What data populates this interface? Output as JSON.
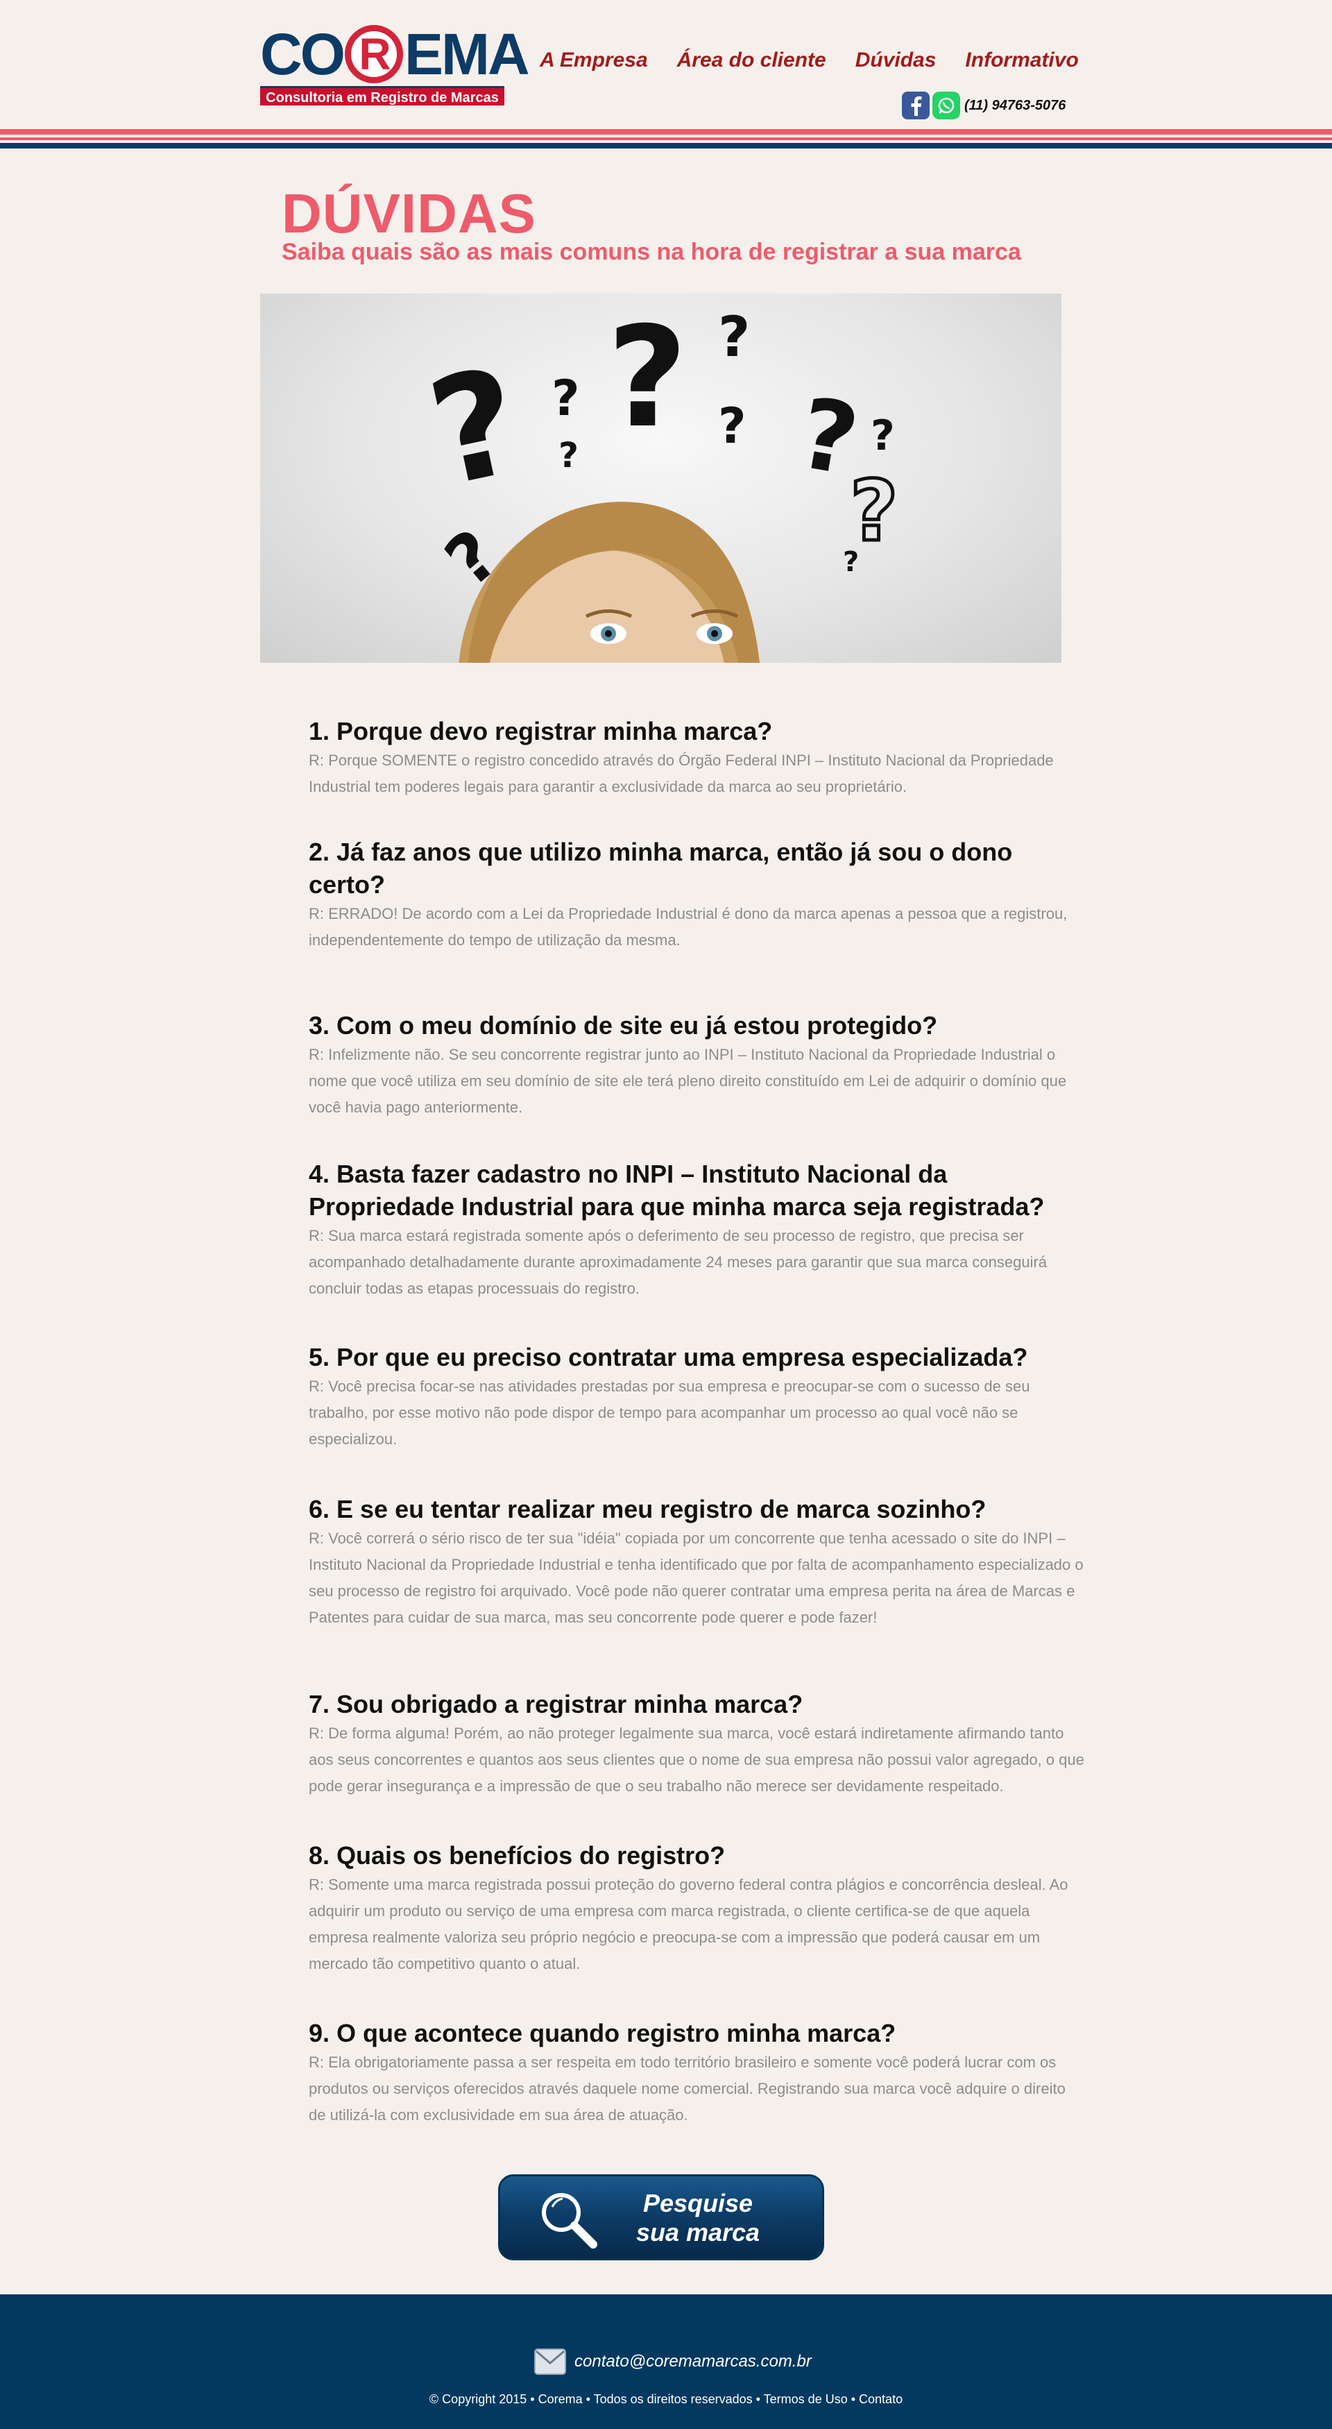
{
  "header": {
    "logo_word_start": "CO",
    "logo_word_r": "R",
    "logo_word_end": "EMA",
    "logo_tagline": "Consultoria em Registro de Marcas",
    "nav": [
      "A Empresa",
      "Área do cliente",
      "Dúvidas",
      "Informativo"
    ],
    "phone": "(11) 94763-5076"
  },
  "page": {
    "title": "DÚVIDAS",
    "subtitle": "Saiba quais são as mais comuns na hora de registrar a sua marca"
  },
  "faq": [
    {
      "question": "1. Porque devo registrar minha marca?",
      "answer": "R: Porque SOMENTE o registro concedido através do Órgão Federal INPI – Instituto Nacional da Propriedade Industrial tem poderes legais para garantir a exclusividade da marca ao seu proprietário."
    },
    {
      "question": "2. Já faz anos que utilizo minha marca, então já sou o dono certo?",
      "answer": "R: ERRADO! De acordo com a Lei da Propriedade Industrial é dono da marca apenas a pessoa que a registrou, independentemente do tempo de utilização da mesma."
    },
    {
      "question": "3. Com o meu domínio de site eu já estou protegido?",
      "answer": "R: Infelizmente não. Se seu concorrente registrar junto ao INPI – Instituto Nacional da Propriedade Industrial o nome que você utiliza em seu domínio de site ele terá pleno direito constituído em Lei de adquirir o domínio que você havia pago anteriormente."
    },
    {
      "question": "4. Basta fazer cadastro no INPI – Instituto Nacional da Propriedade Industrial para que minha marca seja registrada?",
      "answer": "R: Sua marca estará registrada somente após o deferimento de seu processo de registro, que precisa ser acompanhado detalhadamente durante aproximadamente 24 meses para garantir que sua marca conseguirá concluir todas as etapas processuais do registro."
    },
    {
      "question": "5. Por que eu preciso contratar uma empresa especializada?",
      "answer": "R: Você precisa focar-se nas atividades prestadas por sua empresa e preocupar-se com o sucesso de seu trabalho, por esse motivo  não pode dispor de tempo para acompanhar um processo ao qual você não se especializou."
    },
    {
      "question": "6. E se eu tentar realizar meu registro de marca sozinho?",
      "answer": "R: Você correrá o sério risco de ter sua \"idéia\" copiada por um concorrente que tenha acessado o site do INPI – Instituto Nacional da Propriedade Industrial e tenha identificado que por falta de acompanhamento especializado o seu processo de registro foi arquivado. Você pode não querer contratar uma empresa perita na área de Marcas e Patentes para cuidar de sua marca, mas seu concorrente pode querer e pode fazer!"
    },
    {
      "question": "7. Sou obrigado a registrar minha marca?",
      "answer": "R: De forma alguma! Porém, ao não proteger legalmente sua marca, você estará indiretamente afirmando tanto aos  seus concorrentes e quantos aos seus clientes que o nome de sua empresa não possui valor agregado, o que pode gerar insegurança e a impressão de que o seu trabalho não merece ser devidamente respeitado."
    },
    {
      "question": "8. Quais os benefícios do registro?",
      "answer": "R: Somente uma marca registrada possui proteção do governo federal contra plágios e concorrência desleal. Ao adquirir um produto ou serviço de uma empresa com marca registrada, o cliente certifica-se de que aquela empresa realmente valoriza seu próprio negócio e preocupa-se com a impressão que poderá causar em um mercado tão competitivo quanto o atual."
    },
    {
      "question": "9. O que acontece quando registro minha marca?",
      "answer": "R: Ela obrigatoriamente passa a ser respeita em todo território brasileiro e somente você poderá lucrar com os produtos ou serviços oferecidos através daquele nome comercial. Registrando sua marca você adquire o direito de utilizá-la com exclusividade em sua área de atuação."
    }
  ],
  "cta": {
    "line1": "Pesquise",
    "line2": "sua marca"
  },
  "footer": {
    "email": "contato@coremamarcas.com.br",
    "copyright": "© Copyright 2015 • Corema • Todos os direitos reservados • ",
    "terms": "Termos de Uso",
    "separator": " • ",
    "contact": "Contato"
  },
  "colors": {
    "brand_navy": "#0d3b66",
    "brand_red": "#c8102e",
    "title_pink": "#ee5b6b",
    "nav_red": "#a01c1c",
    "footer_bg": "#03395f",
    "page_bg": "#f5f0ec"
  },
  "icons": [
    "facebook-icon",
    "whatsapp-icon",
    "search-magnifier-icon",
    "envelope-icon"
  ]
}
